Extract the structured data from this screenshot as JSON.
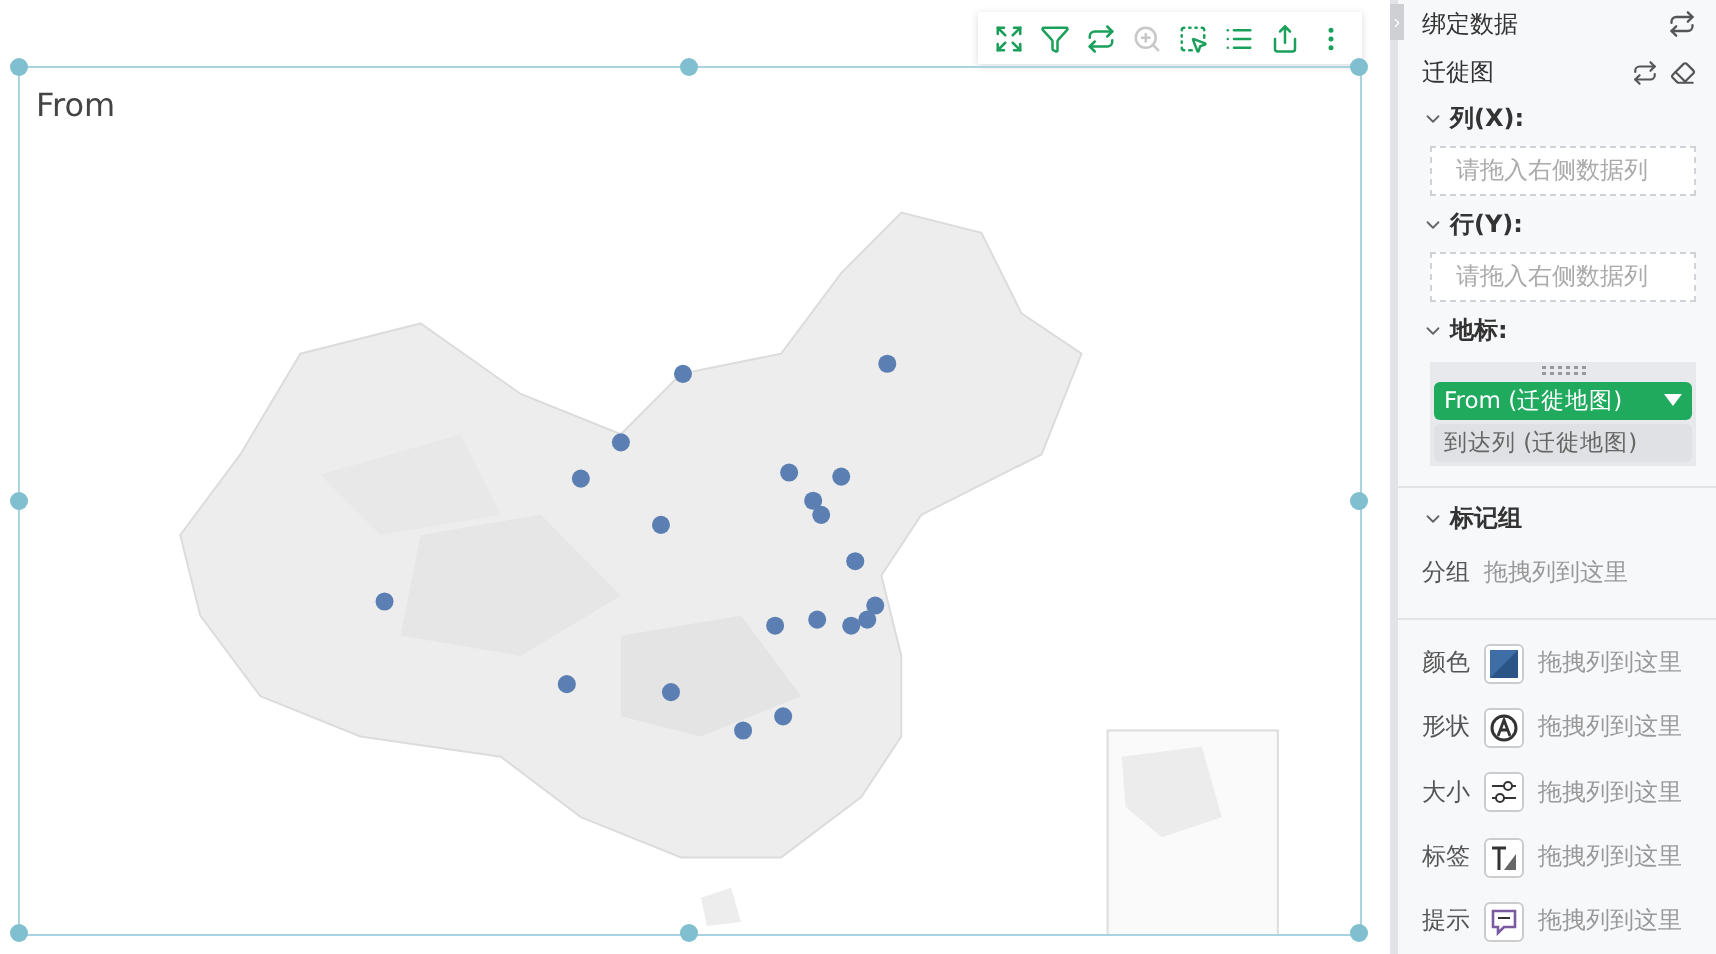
{
  "chart": {
    "title": "From"
  },
  "toolbar": [
    {
      "kind": "expand",
      "disabled": false
    },
    {
      "kind": "filter",
      "disabled": false
    },
    {
      "kind": "swap",
      "disabled": false
    },
    {
      "kind": "zoom",
      "disabled": true
    },
    {
      "kind": "select",
      "disabled": false
    },
    {
      "kind": "list",
      "disabled": false
    },
    {
      "kind": "export",
      "disabled": false
    },
    {
      "kind": "more",
      "disabled": false
    }
  ],
  "panel": {
    "title": "绑定数据",
    "chart_type": "迁徙图",
    "sections": [
      {
        "kind": "drop",
        "label": "列(X):",
        "expanded": true,
        "hint": "请拖入右侧数据列"
      },
      {
        "kind": "drop",
        "label": "行(Y):",
        "expanded": true,
        "hint": "请拖入右侧数据列"
      },
      {
        "kind": "fields",
        "label": "地标:",
        "expanded": true,
        "fields": [
          {
            "label": "From (迁徙地图)",
            "selected": true
          },
          {
            "label": "到达列 (迁徙地图)",
            "selected": false
          }
        ]
      }
    ],
    "mark_group": {
      "label": "标记组",
      "expanded": true,
      "group": {
        "label": "分组",
        "hint": "拖拽列到这里"
      },
      "properties": [
        {
          "kind": "color",
          "label": "颜色",
          "hint": "拖拽列到这里"
        },
        {
          "kind": "shape",
          "label": "形状",
          "hint": "拖拽列到这里"
        },
        {
          "kind": "size",
          "label": "大小",
          "hint": "拖拽列到这里"
        },
        {
          "kind": "label",
          "label": "标签",
          "hint": "拖拽列到这里"
        },
        {
          "kind": "tooltip",
          "label": "提示",
          "hint": "拖拽列到这里"
        }
      ]
    }
  }
}
